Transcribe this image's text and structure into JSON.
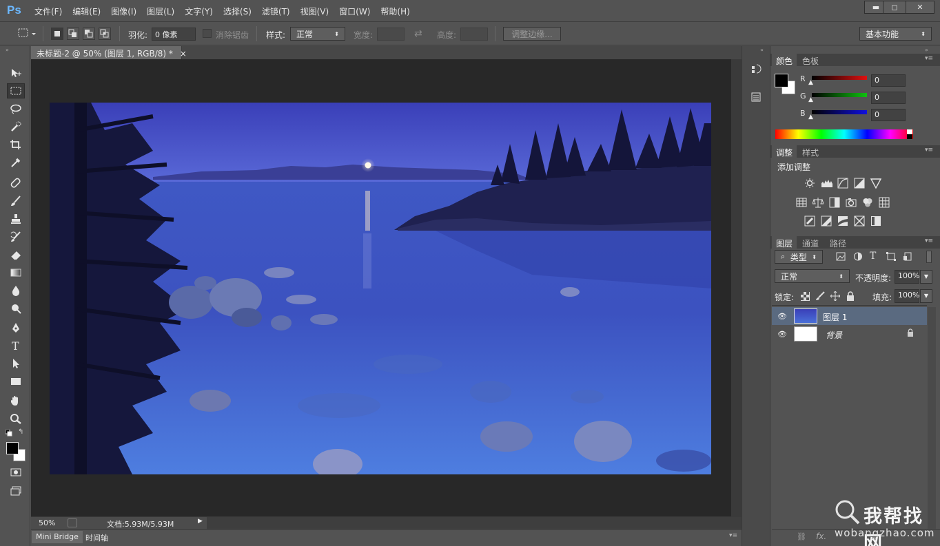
{
  "app": {
    "logo": "Ps"
  },
  "menu": [
    "文件(F)",
    "编辑(E)",
    "图像(I)",
    "图层(L)",
    "文字(Y)",
    "选择(S)",
    "滤镜(T)",
    "视图(V)",
    "窗口(W)",
    "帮助(H)"
  ],
  "window_controls": {
    "minimize": "▬",
    "maximize": "◻",
    "close": "✕"
  },
  "options": {
    "feather_label": "羽化:",
    "feather_value": "0 像素",
    "antialias_label": "消除锯齿",
    "style_label": "样式:",
    "style_value": "正常",
    "width_label": "宽度:",
    "height_label": "高度:",
    "refine_edge_label": "调整边缘...",
    "workspace_value": "基本功能"
  },
  "document": {
    "tab_title": "未标题-2 @ 50% (图层 1, RGB/8) *",
    "tab_close": "×",
    "zoom": "50%",
    "doc_size": "文档:5.93M/5.93M"
  },
  "bottom_tabs": [
    "Mini Bridge",
    "时间轴"
  ],
  "color_panel": {
    "tabs": [
      "颜色",
      "色板"
    ],
    "channels": [
      {
        "label": "R",
        "value": "0",
        "color": "#e01010"
      },
      {
        "label": "G",
        "value": "0",
        "color": "#10c010"
      },
      {
        "label": "B",
        "value": "0",
        "color": "#1010e0"
      }
    ]
  },
  "adjustments_panel": {
    "tabs": [
      "调整",
      "样式"
    ],
    "title": "添加调整",
    "icons": [
      [
        "brightness-icon",
        "levels-icon",
        "curves-icon",
        "exposure-icon",
        "vibrance-icon"
      ],
      [
        "hue-saturation-icon",
        "color-balance-icon",
        "black-white-icon",
        "photo-filter-icon",
        "channel-mixer-icon",
        "color-lookup-icon"
      ],
      [
        "invert-icon",
        "posterize-icon",
        "threshold-icon",
        "gradient-map-icon",
        "selective-color-icon"
      ]
    ]
  },
  "layers_panel": {
    "tabs": [
      "图层",
      "通道",
      "路径"
    ],
    "filter_kind": "类型",
    "blend_mode": "正常",
    "opacity_label": "不透明度:",
    "opacity_value": "100%",
    "lock_label": "锁定:",
    "fill_label": "填充:",
    "fill_value": "100%",
    "layers": [
      {
        "name": "图层 1",
        "selected": true
      },
      {
        "name": "背景",
        "selected": false,
        "locked": true
      }
    ]
  },
  "watermark": {
    "text": "我帮找网",
    "url": "wobangzhao.com"
  },
  "colors": {
    "ps_blue": "#6cb8ff",
    "panel_bg": "#535353",
    "selected_layer": "#5a6a80"
  }
}
